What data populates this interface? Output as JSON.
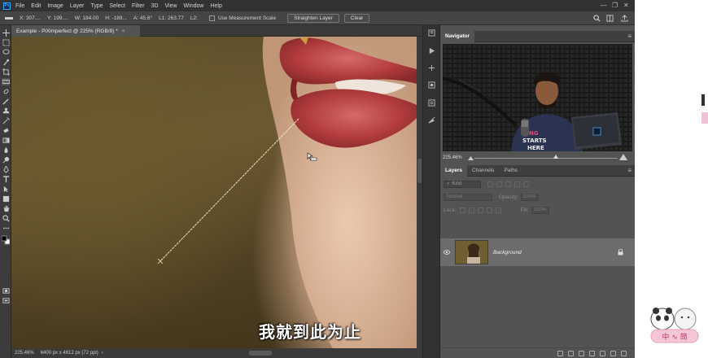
{
  "app": {
    "logo": "Ps",
    "menu": [
      "File",
      "Edit",
      "Image",
      "Layer",
      "Type",
      "Select",
      "Filter",
      "3D",
      "View",
      "Window",
      "Help"
    ],
    "window_controls": [
      "—",
      "❐",
      "✕"
    ]
  },
  "options": {
    "x": "X: 307....",
    "y": "Y: 199....",
    "w": "W: 184.00",
    "h": "H: -189...",
    "a": "A: 45.8°",
    "l1": "L1: 263.77",
    "l2": "L2:",
    "measurement_label": "Use Measurement Scale",
    "straighten_label": "Straighten Layer",
    "clear_label": "Clear"
  },
  "document": {
    "tab_title": "Example - PiXimperfect @ 225% (RGB/8) *",
    "close": "×"
  },
  "status": {
    "zoom": "225.46%",
    "doc_size": "6400 px x 4612 px (72 ppi)",
    "arrow": "›"
  },
  "subtitle": "我就到此为止",
  "navigator": {
    "tab": "Navigator",
    "zoom": "225.46%",
    "shirt_text": "KING STARTS HERE",
    "laptop_icon": "Ps"
  },
  "layers": {
    "tabs": [
      "Layers",
      "Channels",
      "Paths"
    ],
    "kind_placeholder": "Kind",
    "blend_mode": "Normal",
    "opacity_label": "Opacity:",
    "opacity_value": "100%",
    "lock_label": "Lock:",
    "fill_label": "Fill:",
    "fill_value": "100%",
    "layer_name": "Background"
  },
  "sticker": {
    "text": "中 ∿ 简"
  },
  "icons": {
    "eye": "eye-icon",
    "lock": "lock-icon",
    "menu": "panel-menu-icon",
    "search": "search-icon",
    "workspace": "workspace-icon"
  },
  "colors": {
    "ps_blue": "#31a8ff",
    "measure_line": "#f0e6c0",
    "lip_red": "#b03a3a"
  }
}
